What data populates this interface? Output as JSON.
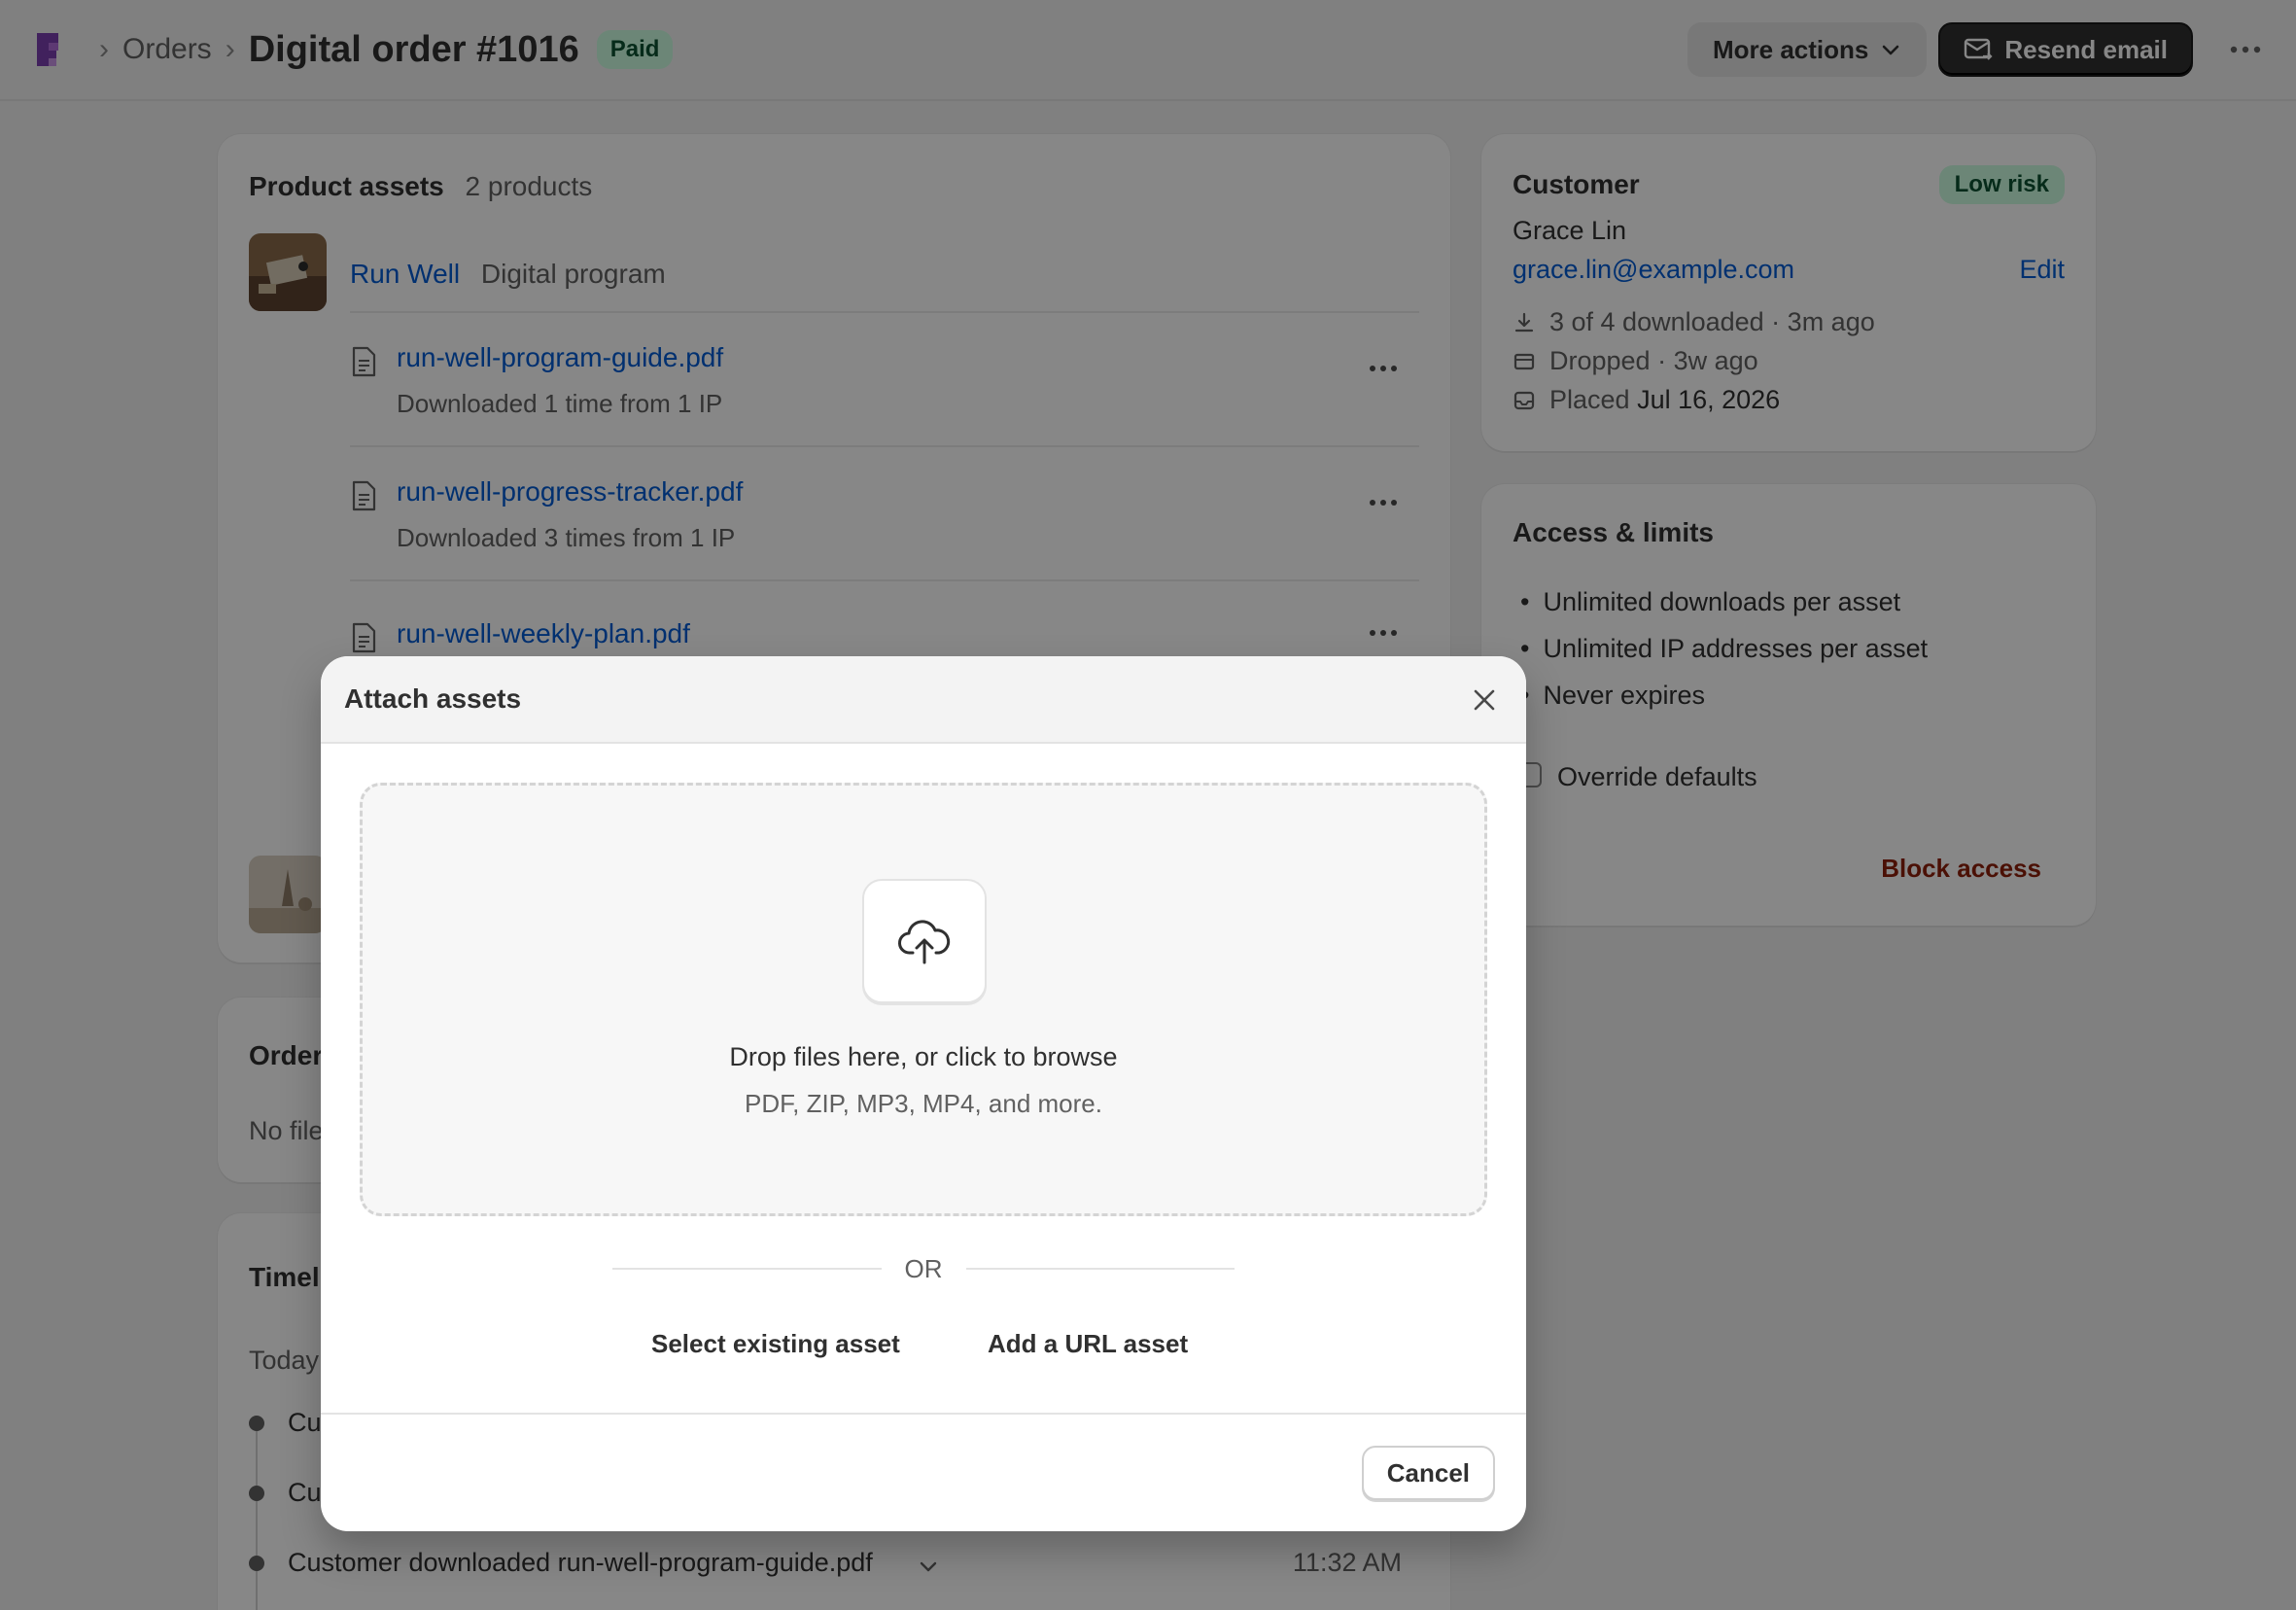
{
  "colors": {
    "primary_text": "#303030",
    "secondary_text": "#616161",
    "link": "#005bd3",
    "success_bg": "#cdfee1",
    "success_text": "#0c5132",
    "critical": "#8e1f0b",
    "brand": "#6b2fa0"
  },
  "header": {
    "breadcrumb_parent": "Orders",
    "title": "Digital order #1016",
    "status_badge": "Paid",
    "more_actions_label": "More actions",
    "resend_label": "Resend email"
  },
  "assets_card": {
    "title": "Product assets",
    "count": "2 products",
    "product": {
      "name": "Run Well",
      "type": "Digital program"
    },
    "files": [
      {
        "name": "run-well-program-guide.pdf",
        "meta": "Downloaded 1 time from 1 IP"
      },
      {
        "name": "run-well-progress-tracker.pdf",
        "meta": "Downloaded 3 times from 1 IP"
      },
      {
        "name": "run-well-weekly-plan.pdf",
        "meta": ""
      }
    ]
  },
  "order_card": {
    "title": "Order",
    "text": "No file"
  },
  "timeline_card": {
    "title": "Timeli",
    "date": "Today",
    "events": [
      {
        "text": "Cu"
      },
      {
        "text": "Cu"
      },
      {
        "text": "Customer downloaded run-well-program-guide.pdf",
        "time": "11:32 AM"
      }
    ]
  },
  "customer_card": {
    "title": "Customer",
    "risk_badge": "Low risk",
    "name": "Grace Lin",
    "email": "grace.lin@example.com",
    "edit_label": "Edit",
    "downloads": "3 of 4 downloaded · 3m ago",
    "dropped": "Dropped · 3w ago",
    "placed_label": "Placed",
    "placed_date": "Jul 16, 2026"
  },
  "access_card": {
    "title": "Access & limits",
    "bullets": [
      "Unlimited downloads per asset",
      "Unlimited IP addresses per asset",
      "Never expires"
    ],
    "override_label": "Override defaults",
    "block_label": "Block access"
  },
  "modal": {
    "title": "Attach assets",
    "drop_title": "Drop files here, or click to browse",
    "drop_subtitle": "PDF, ZIP, MP3, MP4, and more.",
    "or_label": "OR",
    "select_existing_label": "Select existing asset",
    "add_url_label": "Add a URL asset",
    "cancel_label": "Cancel"
  },
  "icons": {
    "logo": "app-logo-icon",
    "chevron": "chevron-down-icon",
    "email": "email-icon",
    "more": "more-horizontal-icon",
    "file": "file-icon",
    "download": "download-icon",
    "cart": "cart-icon",
    "inbox": "inbox-icon",
    "close": "close-icon",
    "upload": "cloud-upload-icon"
  }
}
